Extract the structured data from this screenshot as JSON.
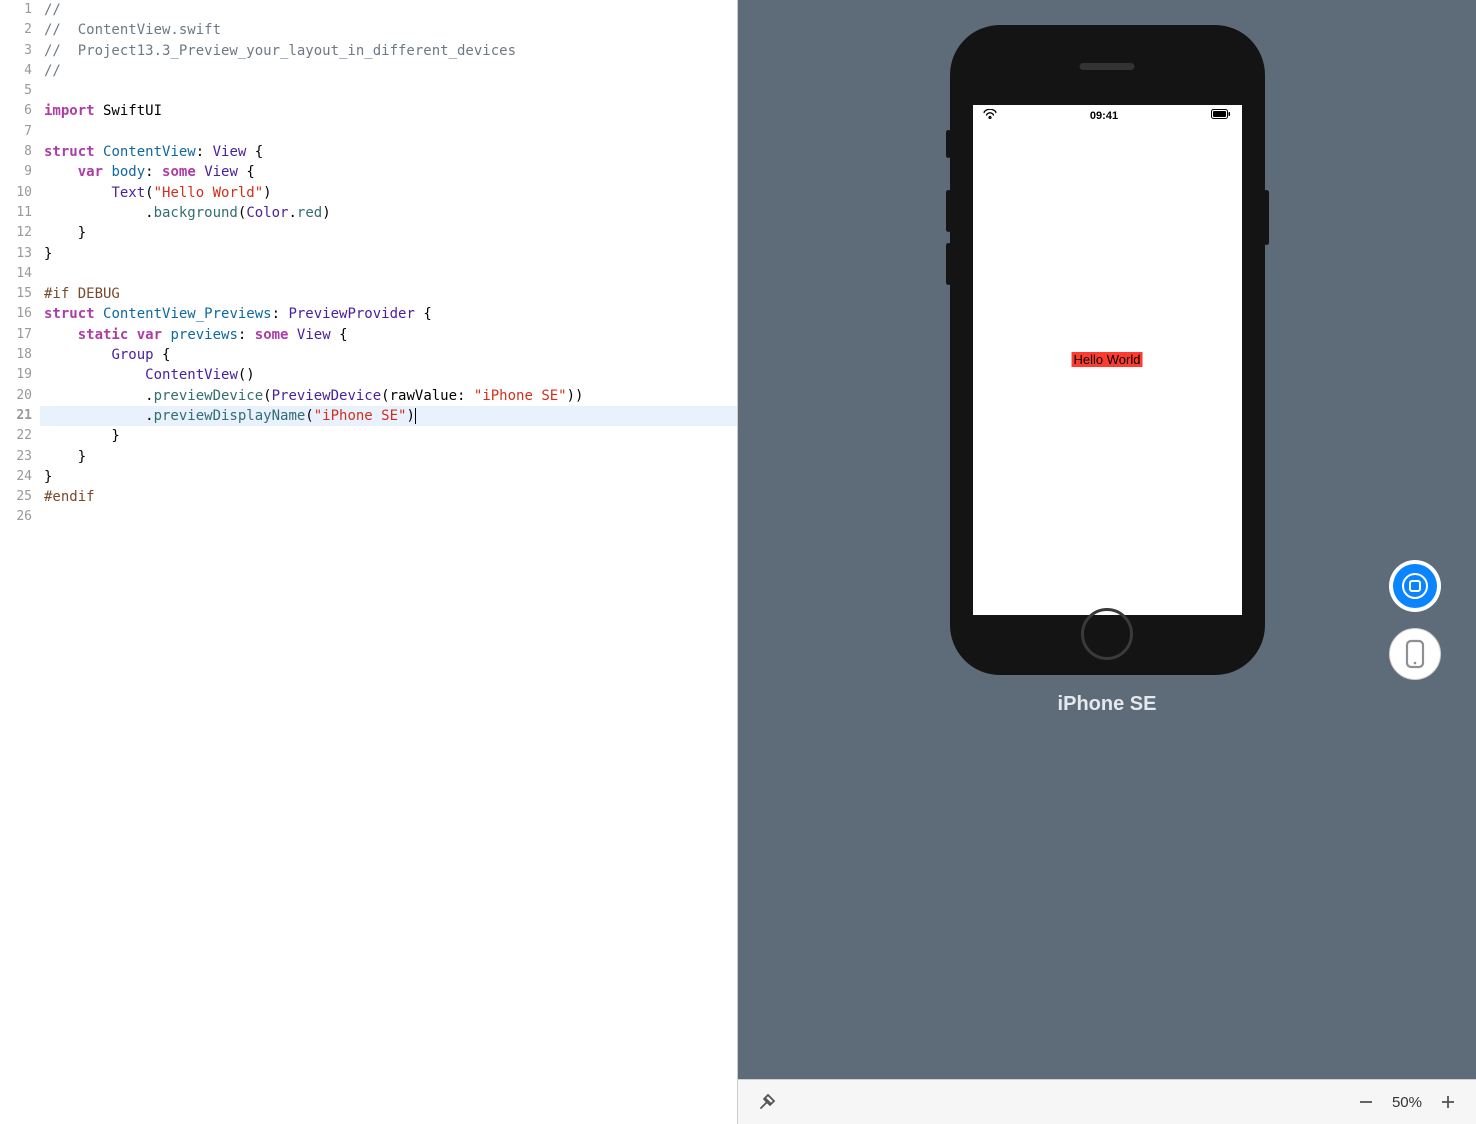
{
  "editor": {
    "lines": [
      {
        "n": 1,
        "tokens": [
          {
            "c": "comment",
            "t": "//"
          }
        ]
      },
      {
        "n": 2,
        "tokens": [
          {
            "c": "comment",
            "t": "//  ContentView.swift"
          }
        ]
      },
      {
        "n": 3,
        "tokens": [
          {
            "c": "comment",
            "t": "//  Project13.3_Preview_your_layout_in_different_devices"
          }
        ]
      },
      {
        "n": 4,
        "tokens": [
          {
            "c": "comment",
            "t": "//"
          }
        ]
      },
      {
        "n": 5,
        "tokens": []
      },
      {
        "n": 6,
        "tokens": [
          {
            "c": "keyword",
            "t": "import"
          },
          {
            "c": "plain",
            "t": " SwiftUI"
          }
        ]
      },
      {
        "n": 7,
        "tokens": []
      },
      {
        "n": 8,
        "tokens": [
          {
            "c": "keyword",
            "t": "struct"
          },
          {
            "c": "plain",
            "t": " "
          },
          {
            "c": "identifier",
            "t": "ContentView"
          },
          {
            "c": "plain",
            "t": ": "
          },
          {
            "c": "type",
            "t": "View"
          },
          {
            "c": "plain",
            "t": " {"
          }
        ]
      },
      {
        "n": 9,
        "tokens": [
          {
            "c": "plain",
            "t": "    "
          },
          {
            "c": "keyword",
            "t": "var"
          },
          {
            "c": "plain",
            "t": " "
          },
          {
            "c": "identifier",
            "t": "body"
          },
          {
            "c": "plain",
            "t": ": "
          },
          {
            "c": "keyword",
            "t": "some"
          },
          {
            "c": "plain",
            "t": " "
          },
          {
            "c": "type",
            "t": "View"
          },
          {
            "c": "plain",
            "t": " {"
          }
        ]
      },
      {
        "n": 10,
        "tokens": [
          {
            "c": "plain",
            "t": "        "
          },
          {
            "c": "type",
            "t": "Text"
          },
          {
            "c": "plain",
            "t": "("
          },
          {
            "c": "string",
            "t": "\"Hello World\""
          },
          {
            "c": "plain",
            "t": ")"
          }
        ]
      },
      {
        "n": 11,
        "tokens": [
          {
            "c": "plain",
            "t": "            ."
          },
          {
            "c": "method",
            "t": "background"
          },
          {
            "c": "plain",
            "t": "("
          },
          {
            "c": "type",
            "t": "Color"
          },
          {
            "c": "plain",
            "t": "."
          },
          {
            "c": "property",
            "t": "red"
          },
          {
            "c": "plain",
            "t": ")"
          }
        ]
      },
      {
        "n": 12,
        "tokens": [
          {
            "c": "plain",
            "t": "    }"
          }
        ]
      },
      {
        "n": 13,
        "tokens": [
          {
            "c": "plain",
            "t": "}"
          }
        ]
      },
      {
        "n": 14,
        "tokens": []
      },
      {
        "n": 15,
        "tokens": [
          {
            "c": "preprocessor",
            "t": "#if DEBUG"
          }
        ]
      },
      {
        "n": 16,
        "tokens": [
          {
            "c": "keyword",
            "t": "struct"
          },
          {
            "c": "plain",
            "t": " "
          },
          {
            "c": "identifier",
            "t": "ContentView_Previews"
          },
          {
            "c": "plain",
            "t": ": "
          },
          {
            "c": "type",
            "t": "PreviewProvider"
          },
          {
            "c": "plain",
            "t": " {"
          }
        ]
      },
      {
        "n": 17,
        "tokens": [
          {
            "c": "plain",
            "t": "    "
          },
          {
            "c": "keyword",
            "t": "static"
          },
          {
            "c": "plain",
            "t": " "
          },
          {
            "c": "keyword",
            "t": "var"
          },
          {
            "c": "plain",
            "t": " "
          },
          {
            "c": "identifier",
            "t": "previews"
          },
          {
            "c": "plain",
            "t": ": "
          },
          {
            "c": "keyword",
            "t": "some"
          },
          {
            "c": "plain",
            "t": " "
          },
          {
            "c": "type",
            "t": "View"
          },
          {
            "c": "plain",
            "t": " {"
          }
        ]
      },
      {
        "n": 18,
        "tokens": [
          {
            "c": "plain",
            "t": "        "
          },
          {
            "c": "type",
            "t": "Group"
          },
          {
            "c": "plain",
            "t": " {"
          }
        ]
      },
      {
        "n": 19,
        "tokens": [
          {
            "c": "plain",
            "t": "            "
          },
          {
            "c": "type",
            "t": "ContentView"
          },
          {
            "c": "plain",
            "t": "()"
          }
        ]
      },
      {
        "n": 20,
        "tokens": [
          {
            "c": "plain",
            "t": "            ."
          },
          {
            "c": "method",
            "t": "previewDevice"
          },
          {
            "c": "plain",
            "t": "("
          },
          {
            "c": "type",
            "t": "PreviewDevice"
          },
          {
            "c": "plain",
            "t": "(rawValue: "
          },
          {
            "c": "string",
            "t": "\"iPhone SE\""
          },
          {
            "c": "plain",
            "t": "))"
          }
        ]
      },
      {
        "n": 21,
        "highlighted": true,
        "cursor": true,
        "tokens": [
          {
            "c": "plain",
            "t": "            ."
          },
          {
            "c": "method",
            "t": "previewDisplayName"
          },
          {
            "c": "plain",
            "t": "("
          },
          {
            "c": "string",
            "t": "\"iPhone SE\""
          },
          {
            "c": "plain",
            "t": ")"
          }
        ]
      },
      {
        "n": 22,
        "tokens": [
          {
            "c": "plain",
            "t": "        }"
          }
        ]
      },
      {
        "n": 23,
        "tokens": [
          {
            "c": "plain",
            "t": "    }"
          }
        ]
      },
      {
        "n": 24,
        "tokens": [
          {
            "c": "plain",
            "t": "}"
          }
        ]
      },
      {
        "n": 25,
        "tokens": [
          {
            "c": "preprocessor",
            "t": "#endif"
          }
        ]
      },
      {
        "n": 26,
        "tokens": []
      }
    ]
  },
  "preview": {
    "device_name": "iPhone SE",
    "status_time": "09:41",
    "app_text": "Hello World",
    "zoom": "50%"
  }
}
